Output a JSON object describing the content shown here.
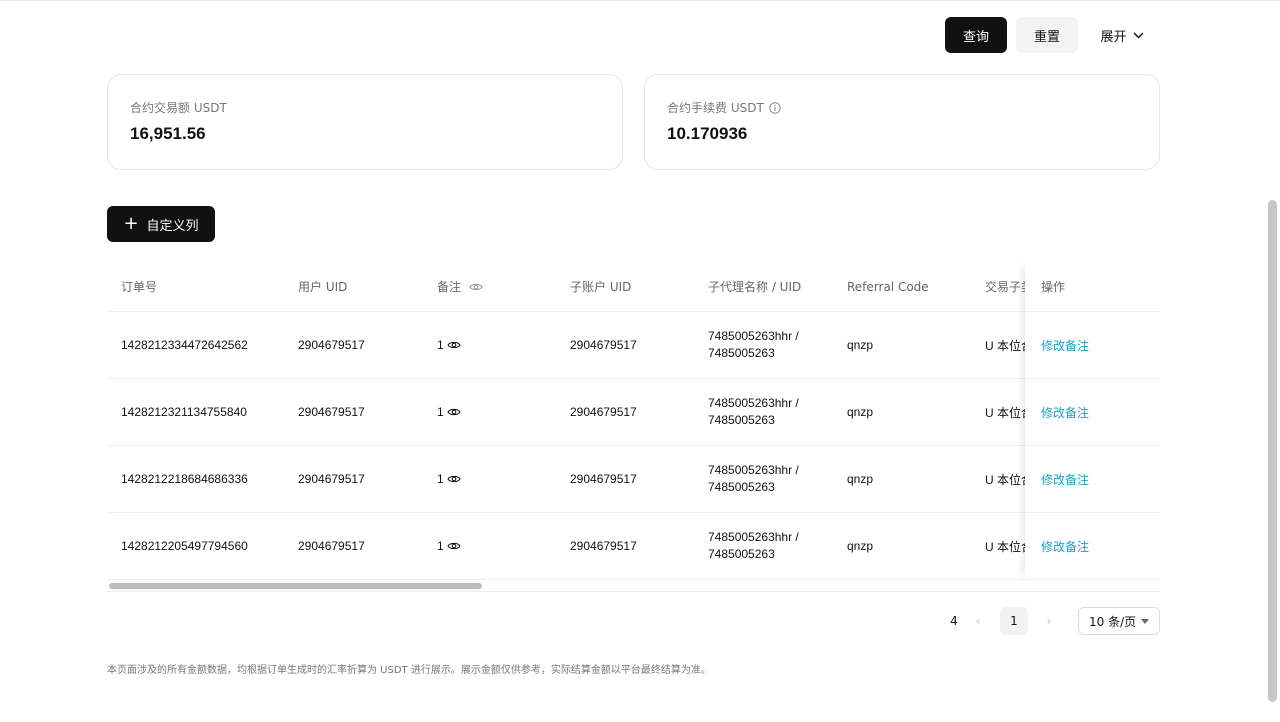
{
  "toolbar": {
    "query_label": "查询",
    "reset_label": "重置",
    "expand_label": "展开"
  },
  "stats": [
    {
      "label": "合约交易额 USDT",
      "value": "16,951.56"
    },
    {
      "label": "合约手续费 USDT",
      "value": "10.170936"
    }
  ],
  "custom_columns_label": "自定义列",
  "table": {
    "headers": [
      "订单号",
      "用户 UID",
      "备注",
      "子账户 UID",
      "子代理名称 / UID",
      "Referral Code",
      "交易子类"
    ],
    "action_header": "操作",
    "rows": [
      {
        "order": "1428212334472642562",
        "uid": "2904679517",
        "remark": "1",
        "sub_uid": "2904679517",
        "agent_name": "7485005263hhr /",
        "agent_uid": "7485005263",
        "referral": "qnzp",
        "type": "U 本位合约",
        "action": "修改备注"
      },
      {
        "order": "1428212321134755840",
        "uid": "2904679517",
        "remark": "1",
        "sub_uid": "2904679517",
        "agent_name": "7485005263hhr /",
        "agent_uid": "7485005263",
        "referral": "qnzp",
        "type": "U 本位合约",
        "action": "修改备注"
      },
      {
        "order": "1428212218684686336",
        "uid": "2904679517",
        "remark": "1",
        "sub_uid": "2904679517",
        "agent_name": "7485005263hhr /",
        "agent_uid": "7485005263",
        "referral": "qnzp",
        "type": "U 本位合约",
        "action": "修改备注"
      },
      {
        "order": "1428212205497794560",
        "uid": "2904679517",
        "remark": "1",
        "sub_uid": "2904679517",
        "agent_name": "7485005263hhr /",
        "agent_uid": "7485005263",
        "referral": "qnzp",
        "type": "U 本位合约",
        "action": "修改备注"
      }
    ]
  },
  "pagination": {
    "total": "4",
    "prev": "‹",
    "current": "1",
    "next": "›",
    "page_size": "10 条/页"
  },
  "footnote": "本页面涉及的所有金额数据，均根据订单生成时的汇率折算为 USDT 进行展示。展示金额仅供参考，实际结算金额以平台最终结算为准。",
  "icons": {
    "eye": "eye-icon",
    "info": "info-icon",
    "chevron": "chevron-down-icon",
    "plus": "plus-icon"
  },
  "colors": {
    "primary": "#111111",
    "link": "#1a9fc8"
  }
}
